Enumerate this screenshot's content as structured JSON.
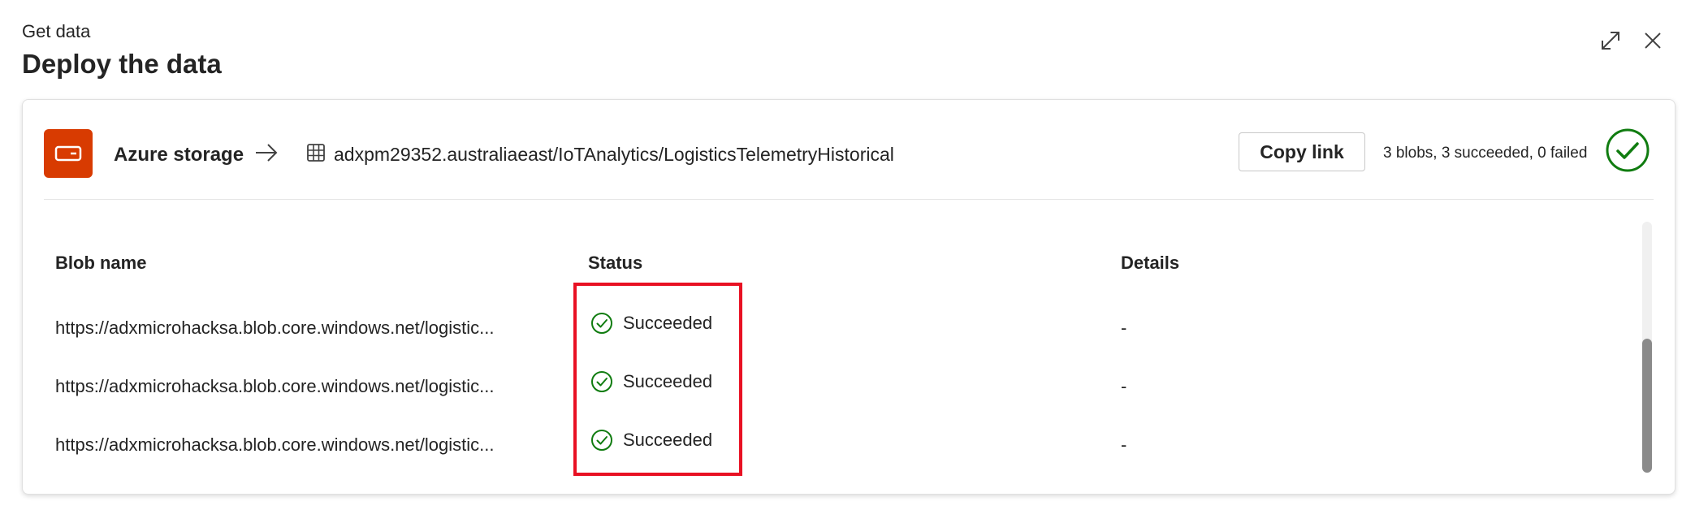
{
  "header": {
    "eyebrow": "Get data",
    "title": "Deploy the data"
  },
  "window_controls": {
    "expand_icon": "expand-icon",
    "close_icon": "close-icon"
  },
  "source": {
    "icon": "azure-storage-icon",
    "label": "Azure storage",
    "icon_color": "#d83b01"
  },
  "destination": {
    "icon": "table-icon",
    "path": "adxpm29352.australiaeast/IoTAnalytics/LogisticsTelemetryHistorical"
  },
  "actions": {
    "copy_link_label": "Copy link"
  },
  "summary": {
    "text": "3 blobs, 3 succeeded, 0 failed",
    "status_color": "#107c10"
  },
  "table": {
    "columns": [
      "Blob name",
      "Status",
      "Details"
    ],
    "rows": [
      {
        "blob_name": "https://adxmicrohacksa.blob.core.windows.net/logistic...",
        "status": "Succeeded",
        "details": "-"
      },
      {
        "blob_name": "https://adxmicrohacksa.blob.core.windows.net/logistic...",
        "status": "Succeeded",
        "details": "-"
      },
      {
        "blob_name": "https://adxmicrohacksa.blob.core.windows.net/logistic...",
        "status": "Succeeded",
        "details": "-"
      }
    ]
  },
  "highlight_color": "#e81123"
}
